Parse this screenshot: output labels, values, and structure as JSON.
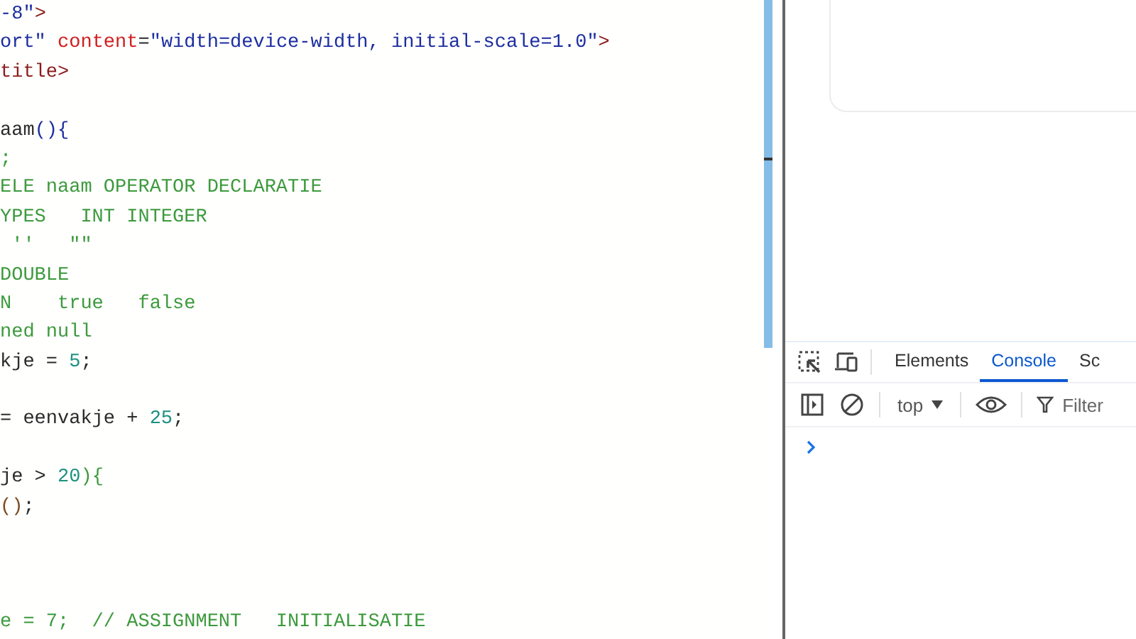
{
  "editor": {
    "lines": [
      {
        "kind": "code",
        "tokens": [
          {
            "kind": "string",
            "text": "-8\""
          },
          {
            "kind": "tag",
            "text": ">"
          }
        ]
      },
      {
        "kind": "code",
        "tokens": [
          {
            "kind": "string",
            "text": "ort\" "
          },
          {
            "kind": "attr",
            "text": "content"
          },
          {
            "kind": "text",
            "text": "="
          },
          {
            "kind": "string",
            "text": "\"width=device-width, initial-scale=1.0\""
          },
          {
            "kind": "tag",
            "text": ">"
          }
        ]
      },
      {
        "kind": "code",
        "tokens": [
          {
            "kind": "tag",
            "text": "title>"
          }
        ]
      },
      {
        "kind": "blank"
      },
      {
        "kind": "code",
        "tokens": [
          {
            "kind": "text",
            "text": "aam"
          },
          {
            "kind": "bracket1",
            "text": "(){"
          }
        ]
      },
      {
        "kind": "code",
        "tokens": [
          {
            "kind": "comment",
            "text": ";"
          }
        ]
      },
      {
        "kind": "code",
        "tokens": [
          {
            "kind": "comment",
            "text": "ELE naam OPERATOR DECLARATIE"
          }
        ]
      },
      {
        "kind": "code",
        "tokens": [
          {
            "kind": "comment",
            "text": "YPES   INT INTEGER"
          }
        ]
      },
      {
        "kind": "code",
        "tokens": [
          {
            "kind": "comment",
            "text": " ''   \"\""
          }
        ]
      },
      {
        "kind": "code",
        "tokens": [
          {
            "kind": "comment",
            "text": "DOUBLE"
          }
        ]
      },
      {
        "kind": "code",
        "tokens": [
          {
            "kind": "comment",
            "text": "N    true   false"
          }
        ]
      },
      {
        "kind": "code",
        "tokens": [
          {
            "kind": "comment",
            "text": "ned null"
          }
        ]
      },
      {
        "kind": "code",
        "tokens": [
          {
            "kind": "text",
            "text": "kje = "
          },
          {
            "kind": "number",
            "text": "5"
          },
          {
            "kind": "text",
            "text": ";"
          }
        ]
      },
      {
        "kind": "blank"
      },
      {
        "kind": "code",
        "tokens": [
          {
            "kind": "text",
            "text": "= eenvakje + "
          },
          {
            "kind": "number",
            "text": "25"
          },
          {
            "kind": "text",
            "text": ";"
          }
        ]
      },
      {
        "kind": "blank"
      },
      {
        "kind": "code",
        "tokens": [
          {
            "kind": "text",
            "text": "je > "
          },
          {
            "kind": "number",
            "text": "20"
          },
          {
            "kind": "bracket2",
            "text": "){"
          }
        ]
      },
      {
        "kind": "code",
        "tokens": [
          {
            "kind": "bracket3",
            "text": "()"
          },
          {
            "kind": "text",
            "text": ";"
          }
        ]
      },
      {
        "kind": "blank"
      },
      {
        "kind": "blank"
      },
      {
        "kind": "blank"
      },
      {
        "kind": "code",
        "tokens": [
          {
            "kind": "comment",
            "text": "e = 7;  // ASSIGNMENT   INITIALISATIE"
          }
        ]
      }
    ]
  },
  "devtools": {
    "tabs": [
      {
        "label": "Elements",
        "selected": false
      },
      {
        "label": "Console",
        "selected": true
      },
      {
        "label": "Sc",
        "selected": false
      }
    ],
    "context": {
      "label": "top"
    },
    "filter": {
      "placeholder": "Filter"
    }
  }
}
